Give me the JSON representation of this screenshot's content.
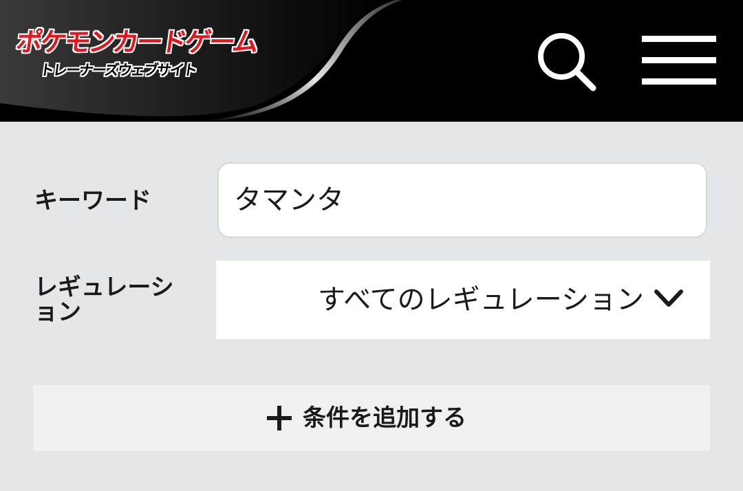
{
  "header": {
    "logo_title": "ポケモンカードゲーム",
    "logo_subtitle": "トレーナーズウェブサイト",
    "search_icon": "search-icon",
    "menu_icon": "hamburger-menu-icon"
  },
  "form": {
    "keyword": {
      "label": "キーワード",
      "value": "タマンタ"
    },
    "regulation": {
      "label_line1": "レギュレーシ",
      "label_line2": "ョン",
      "selected": "すべてのレギュレーション",
      "chevron_icon": "chevron-down-icon"
    },
    "add_condition": {
      "label": "条件を追加する",
      "icon": "plus-icon"
    }
  },
  "colors": {
    "header_bg": "#000000",
    "page_bg": "#e5e6e8",
    "logo_red": "#e8141b"
  }
}
